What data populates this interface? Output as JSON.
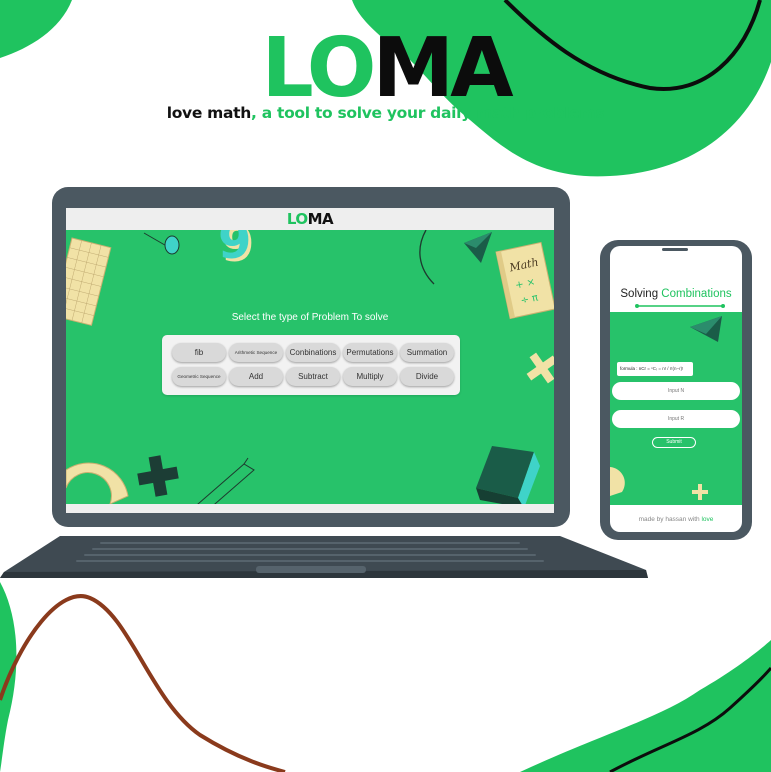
{
  "hero": {
    "logo_lo": "LO",
    "logo_ma": "MA",
    "tagline_black": "love math",
    "tagline_green": ", a tool to solve your daily math problems"
  },
  "laptop": {
    "header_lo": "LO",
    "header_ma": "MA",
    "title": "Select the type of Problem To solve",
    "buttons_row1": [
      "fib",
      "Arithmetic Sequence",
      "Conbinations",
      "Permutations",
      "Summation"
    ],
    "buttons_row2": [
      "Geometric Sequence",
      "Add",
      "Subtract",
      "Multiply",
      "Divide"
    ],
    "math_book_label": "Math",
    "number_nine": "9"
  },
  "phone": {
    "title_plain": "Solving ",
    "title_highlight": "Combinations",
    "formula_label": "formula : nCr =",
    "input_n_placeholder": "Input N",
    "input_r_placeholder": "Input R",
    "submit_label": "Submit",
    "footer_plain": "made by hassan with ",
    "footer_highlight": "love"
  },
  "colors": {
    "brand_green": "#1fc35f",
    "screen_green": "#27c26a",
    "device_gray": "#4b5861",
    "accent_brown": "#8a3a1c"
  }
}
